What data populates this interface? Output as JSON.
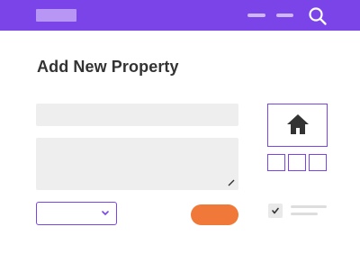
{
  "header": {
    "logo_placeholder": "",
    "nav_items": [
      "",
      ""
    ],
    "search_icon": "search-icon",
    "brand_color": "#7b44e8"
  },
  "main": {
    "title": "Add New Property",
    "text_input_value": "",
    "textarea_value": "",
    "select_value": "",
    "submit_label": "",
    "accent_color": "#f07838"
  },
  "sidebar": {
    "preview_icon": "home-icon",
    "thumbnails": [
      "",
      "",
      ""
    ],
    "checkbox": {
      "checked": true,
      "label": ""
    }
  }
}
